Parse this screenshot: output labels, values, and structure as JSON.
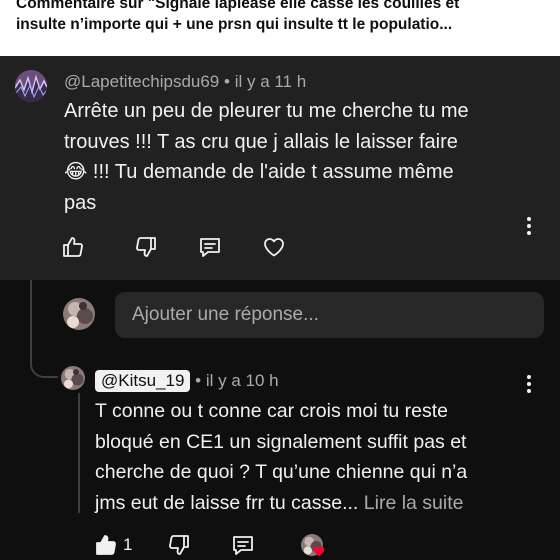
{
  "header": {
    "line1": "Commentaire sur \"Signalé laplease elle casse les couilles et",
    "line2": "insulte n’importe qui + une prsn qui insulte tt le populatio..."
  },
  "comment": {
    "author": "@Lapetitechipsdu69",
    "separator": "•",
    "time": "il y a 11 h",
    "text_lines": [
      "Arrête un peu de pleurer tu me cherche tu me",
      "trouves !!! T as cru que j allais le laisser faire",
      "😂 !!! Tu demande de l'aide t assume même",
      "pas"
    ],
    "icons": [
      "thumbs-up-icon",
      "thumbs-down-icon",
      "reply-icon",
      "heart-icon"
    ]
  },
  "reply_input": {
    "placeholder": "Ajouter une réponse..."
  },
  "reply": {
    "author": "@Kitsu_19",
    "separator": "•",
    "time": "il y a 10 h",
    "text_lines": [
      "T conne ou t conne car crois moi tu reste",
      "bloqué en CE1 un signalement suffit pas et",
      "cherche de quoi ? T qu’une chienne qui n’a",
      "jms eut de laisse frr tu casse..."
    ],
    "read_more": "Lire la suite",
    "like_count": "1",
    "icons": [
      "thumbs-up-filled-icon",
      "thumbs-down-icon",
      "reply-icon",
      "creator-heart-icon"
    ]
  },
  "colors": {
    "background": "#0f0f0f",
    "parent_card": "#212121",
    "text": "#f1f1f1",
    "secondary_text": "#aaaaaa",
    "heart_badge": "#ff0033"
  }
}
